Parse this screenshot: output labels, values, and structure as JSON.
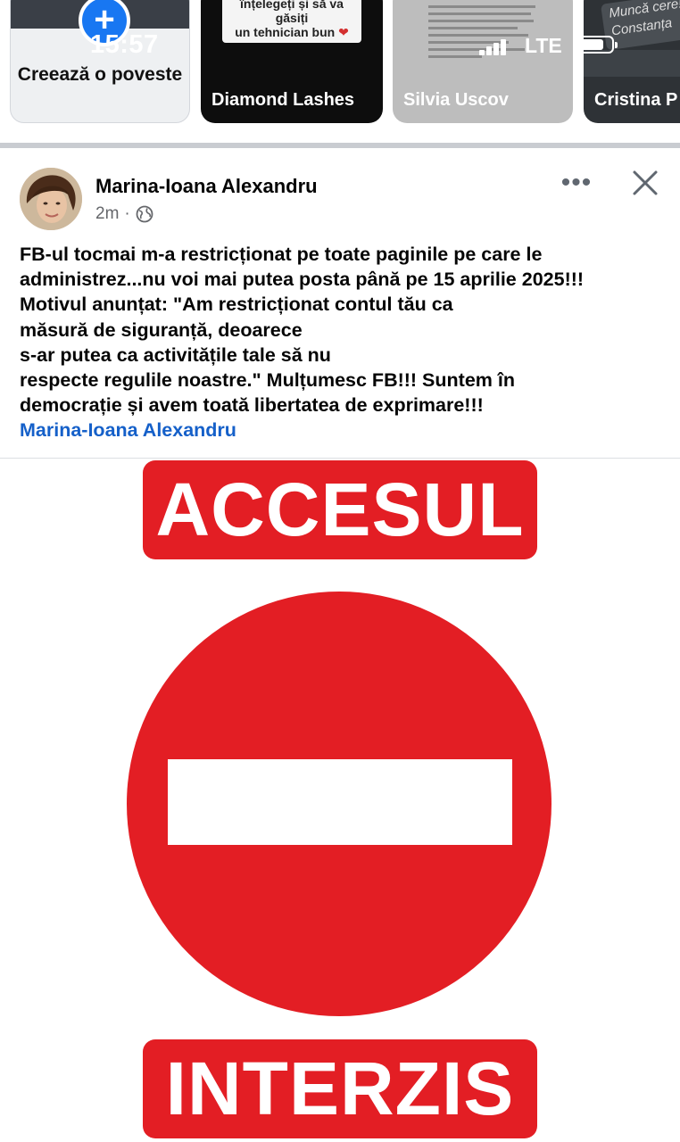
{
  "status_bar": {
    "time": "15:57",
    "network": "LTE"
  },
  "stories": [
    {
      "label": "Creează o poveste"
    },
    {
      "name": "Diamond Lashes",
      "caption_lines": [
        "înțelegeți și să va găsiți",
        "un tehnician bun"
      ]
    },
    {
      "name": "Silvia Uscov"
    },
    {
      "name": "Cristina P",
      "sign_text": "Muncă cere! Constanța"
    }
  ],
  "post": {
    "author": "Marina-Ioana Alexandru",
    "time": "2m",
    "text_lines": [
      "FB-ul tocmai m-a restricționat pe toate paginile pe care le",
      "administrez...nu voi mai putea posta până pe 15 aprilie 2025!!!",
      "Motivul anunțat: \"Am restricționat contul tău ca",
      "măsură de siguranță, deoarece",
      "s-ar putea ca activitățile tale să nu",
      "respecte regulile noastre.\" Mulțumesc FB!!! Suntem în",
      "democrație și avem toată libertatea de exprimare!!!"
    ],
    "tag": "Marina-Ioana Alexandru",
    "image": {
      "top_text": "ACCESUL",
      "bottom_text": "INTERZIS",
      "sign_color": "#e31e24"
    }
  },
  "icons": {
    "plus": "plus-icon",
    "globe": "globe-icon",
    "more": "more-options-icon",
    "close": "close-icon",
    "signal": "signal-icon",
    "battery": "battery-icon"
  },
  "colors": {
    "link": "#1560c9",
    "meta": "#65676b",
    "accent": "#1877f2"
  }
}
